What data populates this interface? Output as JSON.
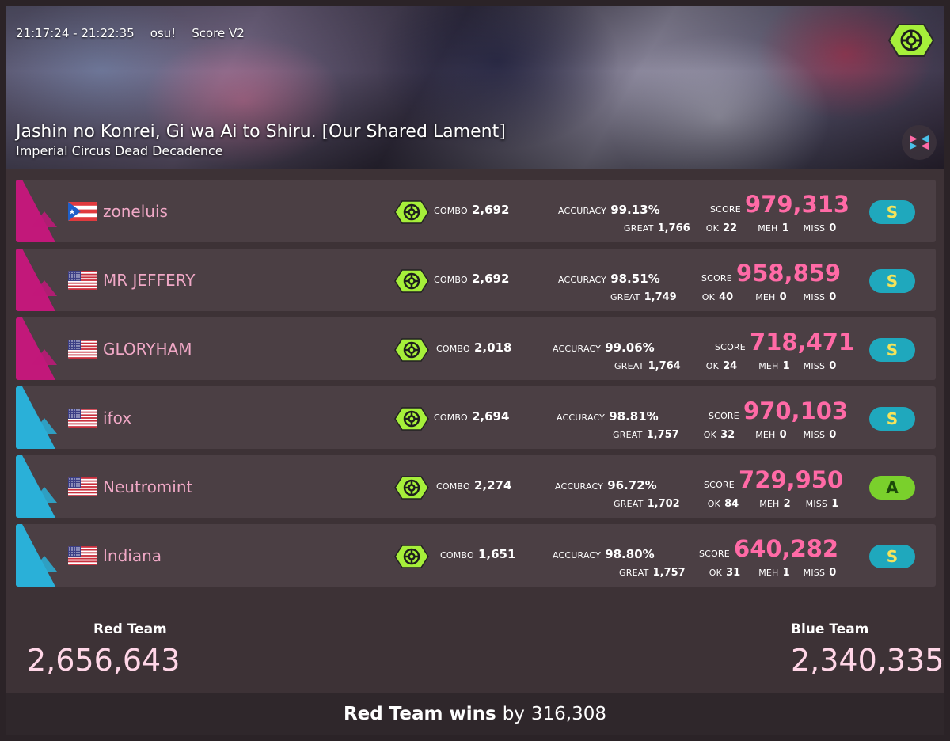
{
  "header": {
    "time_range": "21:17:24 - 21:22:35",
    "ruleset": "osu!",
    "scoring": "Score V2",
    "map_title": "Jashin no Konrei, Gi wa Ai to Shiru. [Our Shared Lament]",
    "map_artist": "Imperial Circus Dead Decadence",
    "mode_icon": "freemod-icon",
    "client_icon": "lazer-icon"
  },
  "labels": {
    "combo": "COMBO",
    "accuracy": "ACCURACY",
    "score": "SCORE",
    "great": "GREAT",
    "ok": "OK",
    "meh": "MEH",
    "miss": "MISS"
  },
  "colors": {
    "red_team": "#c2187a",
    "blue_team": "#2ab0d8",
    "score_pink": "#ff6aa6",
    "name_pink": "#f0a8c6"
  },
  "players": [
    {
      "team": "red",
      "flag": "PR",
      "name": "zoneluis",
      "mod_icon": "freemod-icon",
      "combo": "2,692",
      "accuracy": "99.13%",
      "score": "979,313",
      "great": "1,766",
      "ok": "22",
      "meh": "1",
      "miss": "0",
      "grade": "S"
    },
    {
      "team": "red",
      "flag": "US",
      "name": "MR JEFFERY",
      "mod_icon": "freemod-icon",
      "combo": "2,692",
      "accuracy": "98.51%",
      "score": "958,859",
      "great": "1,749",
      "ok": "40",
      "meh": "0",
      "miss": "0",
      "grade": "S"
    },
    {
      "team": "red",
      "flag": "US",
      "name": "GLORYHAM",
      "mod_icon": "freemod-icon",
      "combo": "2,018",
      "accuracy": "99.06%",
      "score": "718,471",
      "great": "1,764",
      "ok": "24",
      "meh": "1",
      "miss": "0",
      "grade": "S"
    },
    {
      "team": "blue",
      "flag": "US",
      "name": "ifox",
      "mod_icon": "freemod-icon",
      "combo": "2,694",
      "accuracy": "98.81%",
      "score": "970,103",
      "great": "1,757",
      "ok": "32",
      "meh": "0",
      "miss": "0",
      "grade": "S"
    },
    {
      "team": "blue",
      "flag": "US",
      "name": "Neutromint",
      "mod_icon": "freemod-icon",
      "combo": "2,274",
      "accuracy": "96.72%",
      "score": "729,950",
      "great": "1,702",
      "ok": "84",
      "meh": "2",
      "miss": "1",
      "grade": "A"
    },
    {
      "team": "blue",
      "flag": "US",
      "name": "Indiana",
      "mod_icon": "freemod-icon",
      "combo": "1,651",
      "accuracy": "98.80%",
      "score": "640,282",
      "great": "1,757",
      "ok": "31",
      "meh": "1",
      "miss": "0",
      "grade": "S"
    }
  ],
  "teams": {
    "red": {
      "name": "Red Team",
      "score": "2,656,643"
    },
    "blue": {
      "name": "Blue Team",
      "score": "2,340,335"
    }
  },
  "result": {
    "winner": "Red Team wins",
    "by_word": "by",
    "margin": "316,308"
  }
}
